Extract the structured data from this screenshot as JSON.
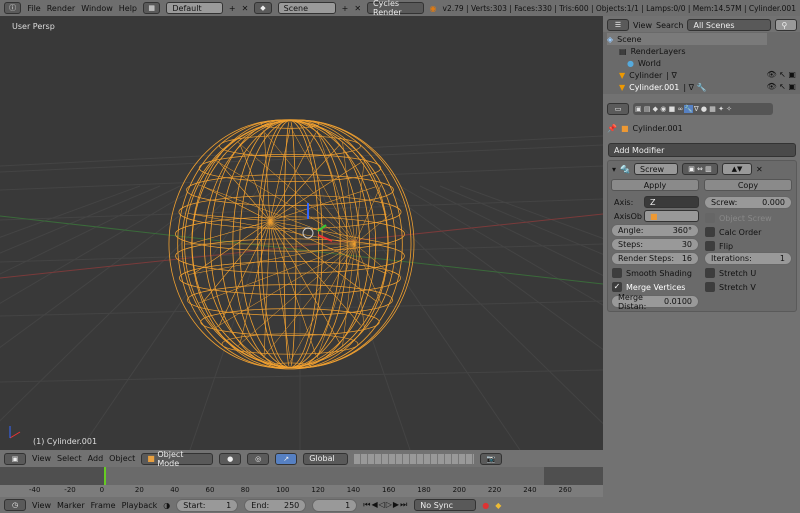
{
  "topbar": {
    "menus": [
      "File",
      "Render",
      "Window",
      "Help"
    ],
    "layout": "Default",
    "scene": "Scene",
    "engine": "Cycles Render",
    "stats": "v2.79 | Verts:303 | Faces:330 | Tris:600 | Objects:1/1 | Lamps:0/0 | Mem:14.57M | Cylinder.001"
  },
  "viewport": {
    "view_label": "User Persp",
    "object_label": "(1) Cylinder.001"
  },
  "outliner": {
    "menus": [
      "View",
      "Search"
    ],
    "filter": "All Scenes",
    "items": [
      "Scene",
      "RenderLayers",
      "World",
      "Cylinder",
      "Cylinder.001"
    ]
  },
  "properties": {
    "object": "Cylinder.001",
    "add_modifier": "Add Modifier",
    "modifier_name": "Screw",
    "apply": "Apply",
    "copy": "Copy",
    "axis_label": "Axis:",
    "axis_value": "Z",
    "axisob_label": "AxisOb",
    "angle_label": "Angle:",
    "angle": "360°",
    "steps_label": "Steps:",
    "steps": "30",
    "render_steps_label": "Render Steps:",
    "render_steps": "16",
    "smooth_shading": "Smooth Shading",
    "merge_vertices": "Merge Vertices",
    "merge_dist_label": "Merge Distan:",
    "merge_dist": "0.0100",
    "screw_label": "Screw:",
    "screw": "0.000",
    "object_screw": "Object Screw",
    "calc_order": "Calc Order",
    "flip": "Flip",
    "iterations_label": "Iterations:",
    "iterations": "1",
    "stretch_u": "Stretch U",
    "stretch_v": "Stretch V",
    "merge_vertices_checked": true
  },
  "view3d_header": {
    "menus": [
      "View",
      "Select",
      "Add",
      "Object"
    ],
    "mode": "Object Mode",
    "orientation": "Global"
  },
  "timeline": {
    "ticks": [
      "-40",
      "-20",
      "0",
      "20",
      "40",
      "60",
      "80",
      "100",
      "120",
      "140",
      "160",
      "180",
      "200",
      "220",
      "240",
      "260"
    ],
    "menus": [
      "View",
      "Marker",
      "Frame",
      "Playback"
    ],
    "start_label": "Start:",
    "start": "1",
    "end_label": "End:",
    "end": "250",
    "current": "1",
    "sync": "No Sync"
  },
  "colors": {
    "wire": "#f0a030",
    "bg": "#393939",
    "panel": "#727272",
    "accent": "#5680c2"
  }
}
